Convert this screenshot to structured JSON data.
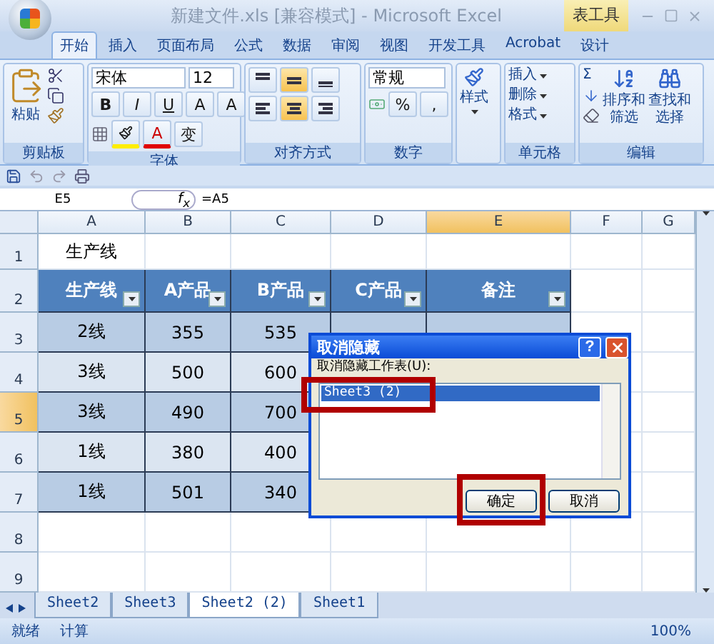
{
  "window": {
    "title": "新建文件.xls  [兼容模式] - Microsoft Excel",
    "context_group": "表工具"
  },
  "ribbon_tabs": [
    {
      "label": "开始",
      "selected": true
    },
    {
      "label": "插入",
      "selected": false
    },
    {
      "label": "页面布局",
      "selected": false
    },
    {
      "label": "公式",
      "selected": false
    },
    {
      "label": "数据",
      "selected": false
    },
    {
      "label": "审阅",
      "selected": false
    },
    {
      "label": "视图",
      "selected": false
    },
    {
      "label": "开发工具",
      "selected": false
    },
    {
      "label": "Acrobat",
      "selected": false
    },
    {
      "label": "设计",
      "selected": false
    }
  ],
  "ribbon_groups": [
    {
      "kind": "clipboard",
      "title": "剪贴板",
      "paste_label": "粘贴"
    },
    {
      "kind": "font",
      "title": "字体",
      "font_name": "宋体",
      "font_size": "12",
      "style_buttons": [
        "B",
        "I",
        "U"
      ],
      "size_buttons": [
        "A",
        "A"
      ],
      "color_glyph": "A",
      "phonetic_glyph": "变"
    },
    {
      "kind": "alignment",
      "title": "对齐方式",
      "vertical": [
        {
          "selected": false
        },
        {
          "selected": true
        },
        {
          "selected": false
        }
      ],
      "horizontal": [
        {
          "selected": false
        },
        {
          "selected": true
        },
        {
          "selected": false
        }
      ]
    },
    {
      "kind": "number",
      "title": "数字",
      "format": "常规",
      "percent": "%",
      "comma": ","
    },
    {
      "kind": "styles",
      "label": "样式"
    },
    {
      "kind": "cells",
      "title": "单元格",
      "items": [
        "插入",
        "删除",
        "格式"
      ]
    },
    {
      "kind": "editing",
      "title": "编辑",
      "sigma": "Σ",
      "sort_lines": [
        "排序和",
        "筛选"
      ],
      "find_lines": [
        "查找和",
        "选择"
      ]
    }
  ],
  "formula_bar": {
    "name_box": "E5",
    "function_glyph": "f$_{x}$",
    "formula": "=A5"
  },
  "sheet": {
    "columns": [
      {
        "label": "A",
        "selected": false
      },
      {
        "label": "B",
        "selected": false
      },
      {
        "label": "C",
        "selected": false
      },
      {
        "label": "D",
        "selected": false
      },
      {
        "label": "E",
        "selected": true
      },
      {
        "label": "F",
        "selected": false
      },
      {
        "label": "G",
        "selected": false
      }
    ],
    "rows": [
      {
        "label": "1",
        "selected": false
      },
      {
        "label": "2",
        "selected": false
      },
      {
        "label": "3",
        "selected": false
      },
      {
        "label": "4",
        "selected": false
      },
      {
        "label": "5",
        "selected": true
      },
      {
        "label": "6",
        "selected": false
      },
      {
        "label": "7",
        "selected": false
      },
      {
        "label": "8",
        "selected": false
      },
      {
        "label": "9",
        "selected": false
      }
    ],
    "title_cell": "生产线",
    "table_headers": [
      "生产线",
      "A产品",
      "B产品",
      "C产品",
      "备注"
    ],
    "table_rows": [
      [
        "2线",
        "355",
        "535"
      ],
      [
        "3线",
        "500",
        "600"
      ],
      [
        "3线",
        "490",
        "700"
      ],
      [
        "1线",
        "380",
        "400"
      ],
      [
        "1线",
        "501",
        "340"
      ]
    ]
  },
  "sheet_tabs": [
    {
      "label": "Sheet2",
      "selected": false
    },
    {
      "label": "Sheet3",
      "selected": false
    },
    {
      "label": "Sheet2 (2)",
      "selected": true
    },
    {
      "label": "Sheet1",
      "selected": false
    }
  ],
  "status_bar": {
    "items": [
      "就绪",
      "计算"
    ],
    "zoom": "100%"
  },
  "dialog": {
    "title": "取消隐藏",
    "help": "?",
    "label": "取消隐藏工作表(U):",
    "items": [
      {
        "label": "Sheet3 (2)",
        "selected": true
      }
    ],
    "buttons": [
      "确定",
      "取消"
    ]
  },
  "annotations": [
    {
      "color": "#b00000"
    },
    {
      "color": "#b00000"
    }
  ]
}
